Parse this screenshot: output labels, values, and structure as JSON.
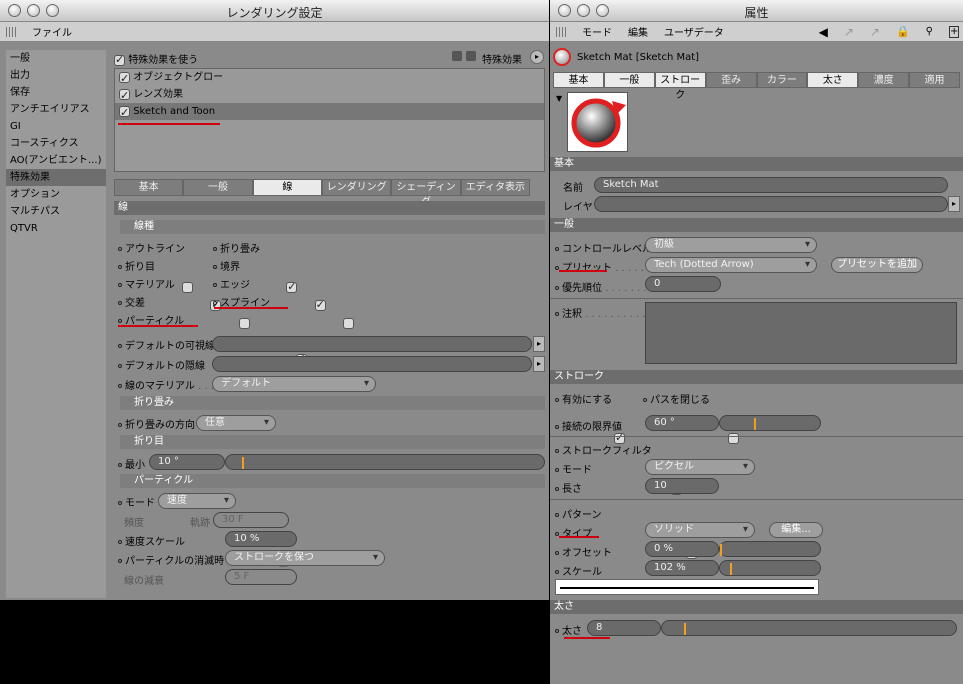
{
  "left": {
    "title": "レンダリング設定",
    "menu_file": "ファイル",
    "sidebar": [
      "一般",
      "出力",
      "保存",
      "アンチエイリアス",
      "GI",
      "コースティクス",
      "AO(アンビエント...)",
      "特殊効果",
      "オプション",
      "マルチパス",
      "QTVR"
    ],
    "use_effects": "特殊効果を使う",
    "effects_btn": "特殊効果",
    "effects": [
      "オブジェクトグロー",
      "レンズ効果",
      "Sketch and Toon"
    ],
    "tabs": [
      "基本",
      "一般",
      "線",
      "レンダリング",
      "シェーディング",
      "エディタ表示"
    ],
    "sec_line": "線",
    "sub_linetype": "線種",
    "linetypes": [
      "アウトライン",
      "折り畳み",
      "折り目",
      "境界",
      "マテリアル",
      "エッジ",
      "交差",
      "スプライン",
      "パーティクル"
    ],
    "default_visible": "デフォルトの可視線",
    "default_hidden": "デフォルトの隠線",
    "line_material": "線のマテリアル",
    "line_material_val": "デフォルト",
    "sub_fold": "折り畳み",
    "fold_dir": "折り畳みの方向",
    "fold_dir_val": "任意",
    "sub_crease": "折り目",
    "min": "最小",
    "min_val": "10 °",
    "sub_particle": "パーティクル",
    "mode": "モード",
    "mode_val": "速度",
    "density": "頻度",
    "trail": "軌跡",
    "trail_val": "30 F",
    "speed_scale": "速度スケール",
    "speed_scale_val": "10 %",
    "particle_fade": "パーティクルの消滅時",
    "particle_fade_val": "ストロークを保つ",
    "line_decay": "線の減衰",
    "line_decay_val": "5 F"
  },
  "right": {
    "title": "属性",
    "menu": [
      "モード",
      "編集",
      "ユーザデータ"
    ],
    "mat_name": "Sketch Mat [Sketch Mat]",
    "tabs1": [
      "基本",
      "一般",
      "ストローク",
      "歪み",
      "カラー",
      "太さ",
      "濃度",
      "適用"
    ],
    "sec_basic": "基本",
    "name_lbl": "名前",
    "name_val": "Sketch Mat",
    "layer_lbl": "レイヤ",
    "sec_general": "一般",
    "control_lbl": "コントロールレベル",
    "control_val": "初級",
    "preset_lbl": "プリセット",
    "preset_val": "Tech (Dotted Arrow)",
    "preset_add": "プリセットを追加",
    "priority_lbl": "優先順位",
    "priority_val": "0",
    "note_lbl": "注釈",
    "sec_stroke": "ストローク",
    "enable_lbl": "有効にする",
    "close_path_lbl": "パスを閉じる",
    "joint_lbl": "接続の限界値",
    "joint_val": "60 °",
    "filter_lbl": "ストロークフィルタ",
    "mode_lbl": "モード",
    "mode_val": "ピクセル",
    "length_lbl": "長さ",
    "length_val": "10",
    "pattern_lbl": "パターン",
    "type_lbl": "タイプ",
    "type_val": "ソリッド",
    "edit_btn": "編集...",
    "offset_lbl": "オフセット",
    "offset_val": "0 %",
    "scale_lbl": "スケール",
    "scale_val": "102 %",
    "sec_thick": "太さ",
    "thick_lbl": "太さ",
    "thick_val": "8"
  },
  "colors": {
    "underline": "#d00010",
    "slider_mark": "#f0a020"
  }
}
